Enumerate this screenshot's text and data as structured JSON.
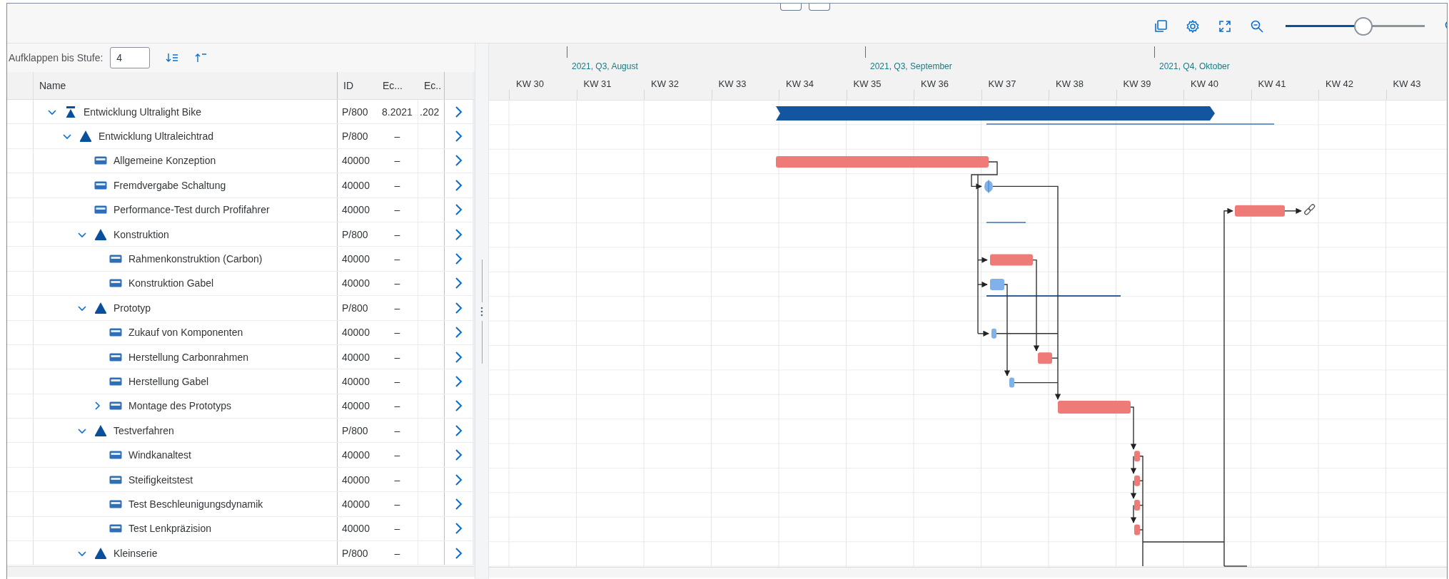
{
  "toolbar": {
    "zoom_slider": {
      "level": 0.56
    }
  },
  "expand_control": {
    "label": "Aufklappen bis Stufe:",
    "value": "4"
  },
  "table": {
    "columns": [
      "Name",
      "ID",
      "Ec...",
      "Ec.."
    ],
    "rows": [
      {
        "name": "Entwicklung Ultralight Bike",
        "id": "P/800",
        "column_3": "8.2021",
        "column_4": ".202",
        "kind": "project",
        "expandable": true,
        "expanded": true,
        "children": [
          {
            "name": "Entwicklung Ultraleichtrad",
            "id": "P/800",
            "column_3": "–",
            "kind": "phase",
            "expandable": true,
            "expanded": true,
            "children": [
              {
                "name": "Allgemeine Konzeption",
                "id": "40000",
                "column_3": "–",
                "kind": "task",
                "expandable": false
              },
              {
                "name": "Fremdvergabe Schaltung",
                "id": "40000",
                "column_3": "–",
                "kind": "task",
                "expandable": false
              },
              {
                "name": "Performance-Test durch Profifahrer",
                "id": "40000",
                "column_3": "–",
                "kind": "task",
                "expandable": false
              },
              {
                "name": "Konstruktion",
                "id": "P/800",
                "column_3": "–",
                "kind": "phase",
                "expandable": true,
                "expanded": true,
                "children": [
                  {
                    "name": "Rahmenkonstruktion (Carbon)",
                    "id": "40000",
                    "column_3": "–",
                    "kind": "task",
                    "expandable": false
                  },
                  {
                    "name": "Konstruktion Gabel",
                    "id": "40000",
                    "column_3": "–",
                    "kind": "task",
                    "expandable": false
                  }
                ]
              },
              {
                "name": "Prototyp",
                "id": "P/800",
                "column_3": "–",
                "kind": "phase",
                "expandable": true,
                "expanded": true,
                "children": [
                  {
                    "name": "Zukauf von Komponenten",
                    "id": "40000",
                    "column_3": "–",
                    "kind": "task",
                    "expandable": false
                  },
                  {
                    "name": "Herstellung Carbonrahmen",
                    "id": "40000",
                    "column_3": "–",
                    "kind": "task",
                    "expandable": false
                  },
                  {
                    "name": "Herstellung Gabel",
                    "id": "40000",
                    "column_3": "–",
                    "kind": "task",
                    "expandable": false
                  },
                  {
                    "name": "Montage des Prototyps",
                    "id": "40000",
                    "column_3": "–",
                    "kind": "task",
                    "expandable": true,
                    "expanded": false
                  }
                ]
              },
              {
                "name": "Testverfahren",
                "id": "P/800",
                "column_3": "–",
                "kind": "phase",
                "expandable": true,
                "expanded": true,
                "children": [
                  {
                    "name": "Windkanaltest",
                    "id": "40000",
                    "column_3": "–",
                    "kind": "task",
                    "expandable": false
                  },
                  {
                    "name": "Steifigkeitstest",
                    "id": "40000",
                    "column_3": "–",
                    "kind": "task",
                    "expandable": false
                  },
                  {
                    "name": "Test Beschleunigungsdynamik",
                    "id": "40000",
                    "column_3": "–",
                    "kind": "task",
                    "expandable": false
                  },
                  {
                    "name": "Test Lenkpräzision",
                    "id": "40000",
                    "column_3": "–",
                    "kind": "task",
                    "expandable": false
                  }
                ]
              },
              {
                "name": "Kleinserie",
                "id": "P/800",
                "column_3": "–",
                "kind": "phase",
                "expandable": true,
                "expanded": true
              }
            ]
          }
        ]
      }
    ]
  },
  "timeline": {
    "months": [
      "2021, Q3, August",
      "2021, Q3, September",
      "2021, Q4, Oktober"
    ],
    "weeks": [
      "KW 30",
      "KW 31",
      "KW 32",
      "KW 33",
      "KW 34",
      "KW 35",
      "KW 36",
      "KW 37",
      "KW 38",
      "KW 39",
      "KW 40",
      "KW 41",
      "KW 42",
      "KW 43"
    ]
  }
}
